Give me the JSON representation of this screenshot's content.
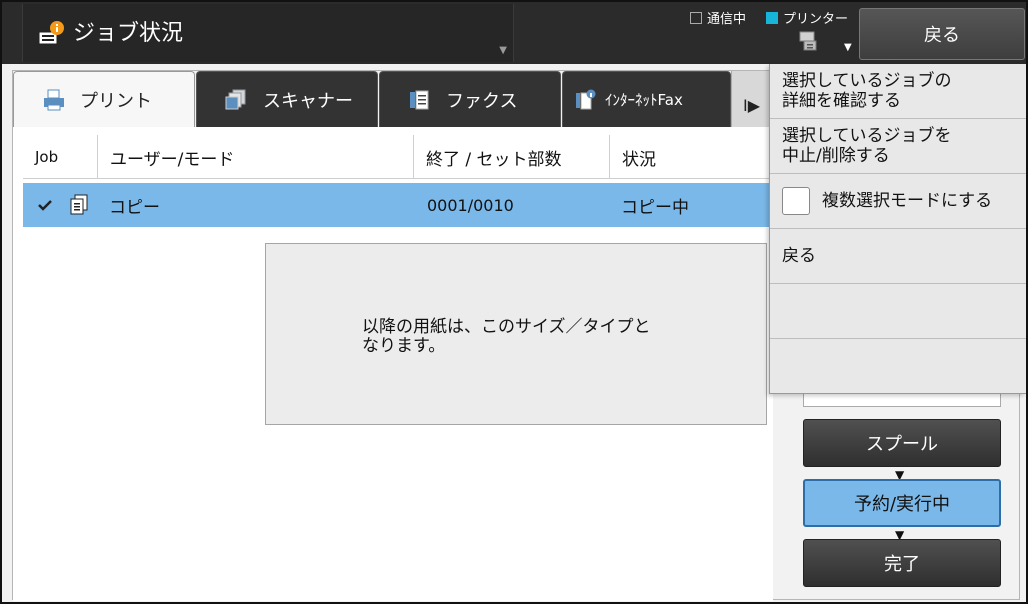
{
  "header": {
    "title": "ジョブ状況",
    "status": {
      "comm_label": "通信中",
      "printer_label": "プリンター",
      "printer_color": "#17b5d8"
    },
    "back_label": "戻る"
  },
  "tabs": [
    {
      "label": "プリント",
      "icon": "print-icon",
      "active": true
    },
    {
      "label": "スキャナー",
      "icon": "scanner-icon",
      "active": false
    },
    {
      "label": "ファクス",
      "icon": "fax-icon",
      "active": false
    },
    {
      "label": "ｲﾝﾀｰﾈｯﾄFax",
      "icon": "internet-fax-icon",
      "active": false
    }
  ],
  "tab_scroll_label": "I▶",
  "table": {
    "columns": [
      "Job",
      "ユーザー/モード",
      "終了 / セット部数",
      "状況"
    ],
    "rows": [
      {
        "user_mode": "コピー",
        "count": "0001/0010",
        "status": "コピー中",
        "selected": true
      }
    ]
  },
  "dialog": {
    "message_line1": "以降の用紙は、このサイズ／タイプと",
    "message_line2": "なります。"
  },
  "menu": {
    "items": [
      {
        "line1": "選択しているジョブの",
        "line2": "詳細を確認する"
      },
      {
        "line1": "選択しているジョブを",
        "line2": "中止/削除する"
      },
      {
        "label": "複数選択モードにする",
        "checkbox": true
      },
      {
        "label": "戻る"
      },
      {
        "label": ""
      },
      {
        "label": ""
      }
    ]
  },
  "stages": {
    "spool": "スプール",
    "active": "予約/実行中",
    "done": "完了"
  },
  "colors": {
    "accent": "#7ab8ea",
    "header_bg": "#2b2b2b"
  }
}
